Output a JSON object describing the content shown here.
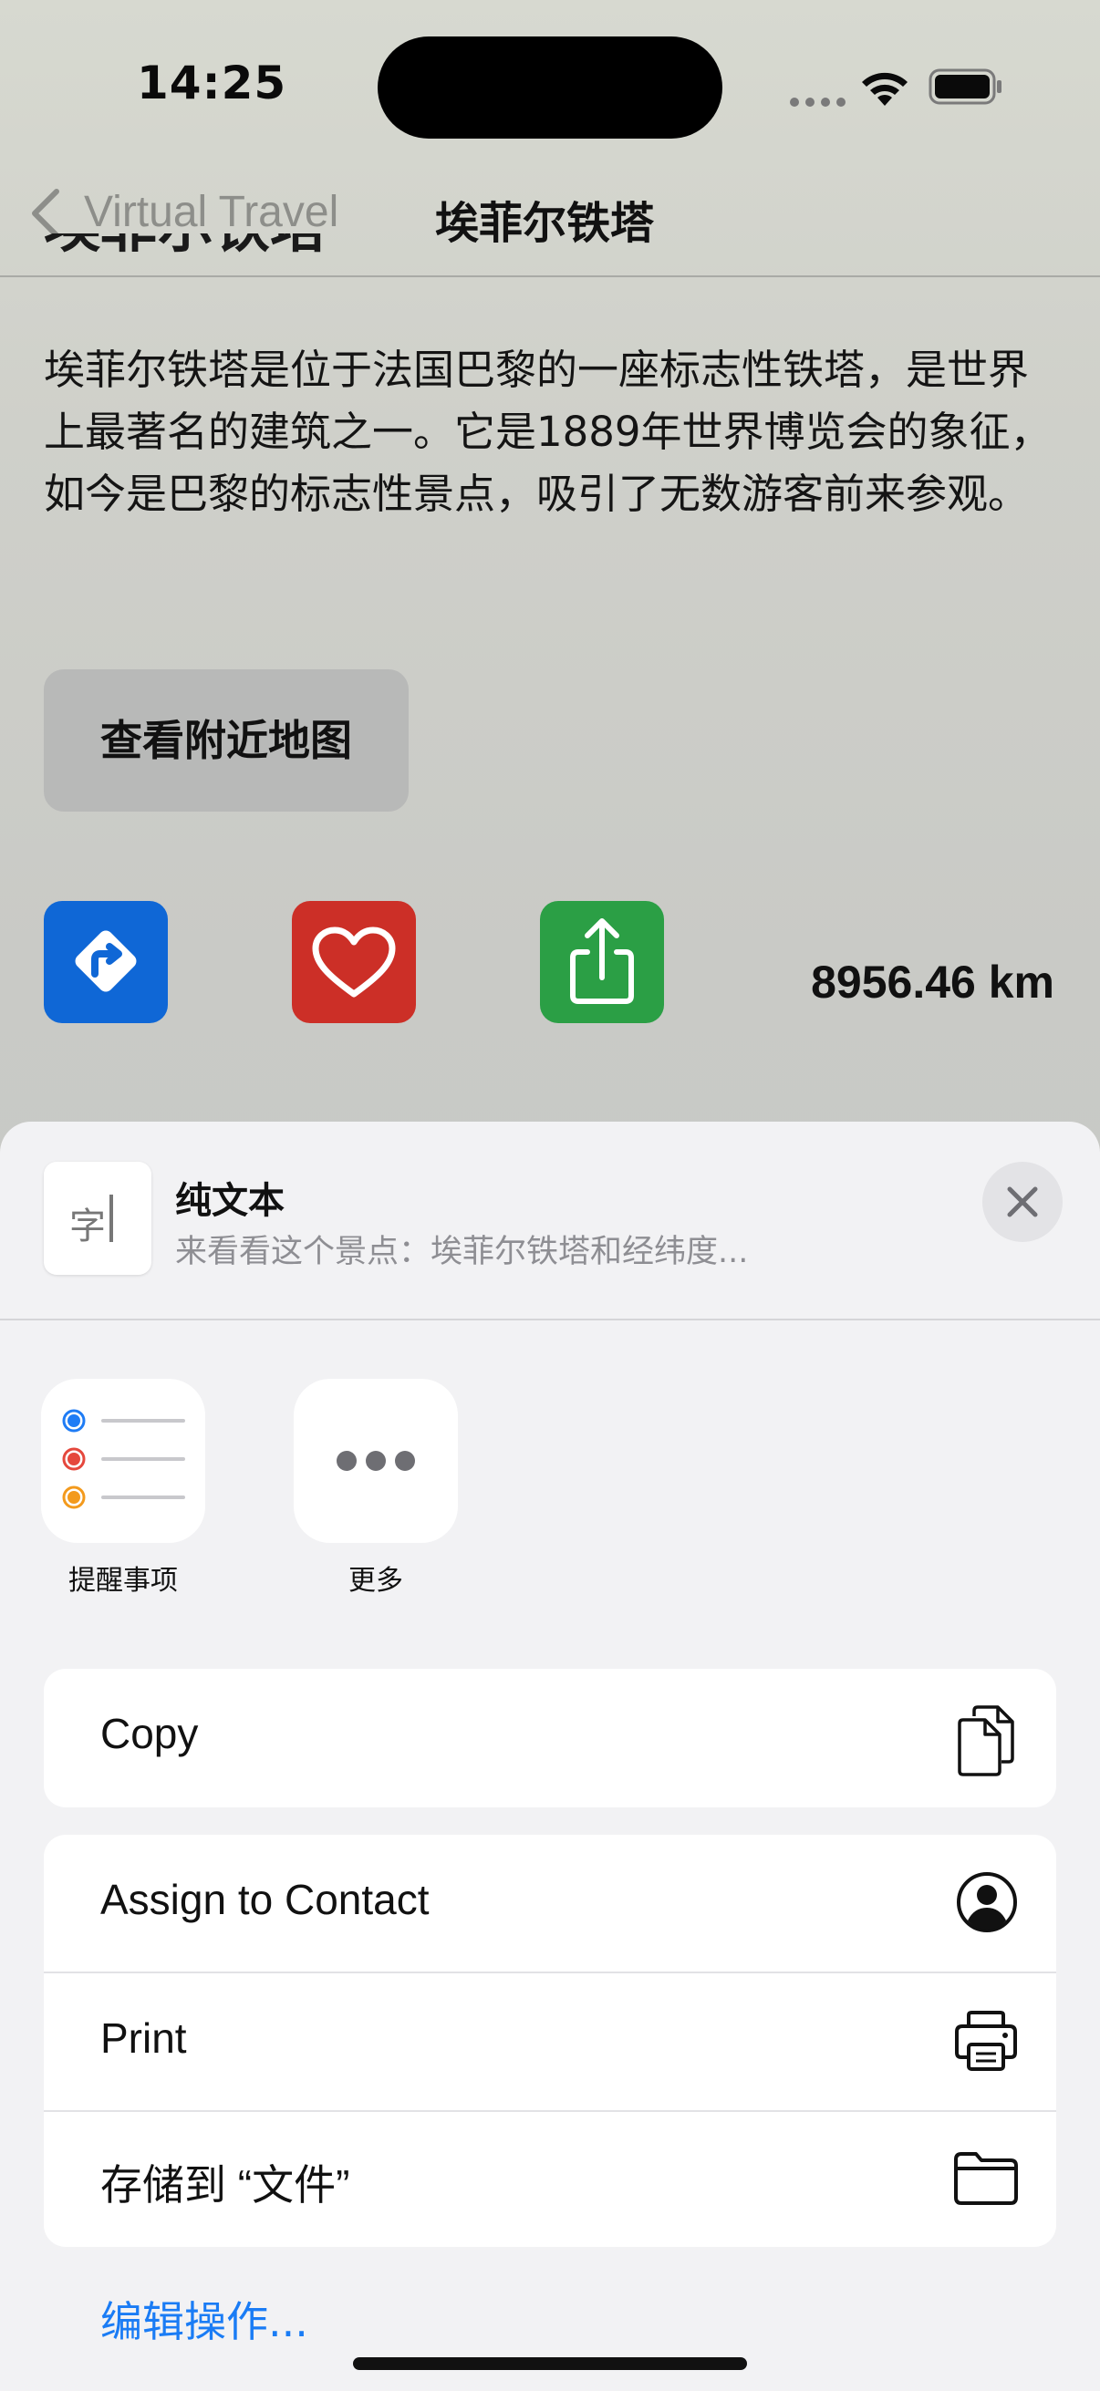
{
  "status_bar": {
    "time": "14:25"
  },
  "nav": {
    "back_label": "Virtual Travel",
    "title": "埃菲尔铁塔"
  },
  "content": {
    "heading": "埃菲尔铁塔",
    "description": "埃菲尔铁塔是位于法国巴黎的一座标志性铁塔，是世界上最著名的建筑之一。它是1889年世界博览会的象征，如今是巴黎的标志性景点，吸引了无数游客前来参观。",
    "map_button": "查看附近地图",
    "distance": "8956.46 km",
    "action_icons": [
      "directions-icon",
      "heart-icon",
      "share-icon"
    ],
    "colors": {
      "route": "#0f67d6",
      "favorite": "#cc2f27",
      "share": "#2b9f45"
    }
  },
  "share_sheet": {
    "thumb_text": "字",
    "title": "纯文本",
    "subtitle": "来看看这个景点：埃菲尔铁塔和经纬度...",
    "apps": [
      {
        "label": "提醒事项",
        "icon": "reminders-icon"
      },
      {
        "label": "更多",
        "icon": "more-icon"
      }
    ],
    "copy": {
      "label": "Copy",
      "icon": "copy-icon"
    },
    "actions": [
      {
        "label": "Assign to Contact",
        "icon": "contact-icon"
      },
      {
        "label": "Print",
        "icon": "printer-icon"
      },
      {
        "label": "存储到 “文件”",
        "icon": "folder-icon"
      }
    ],
    "edit_actions": "编辑操作...",
    "accent_color": "#1a7cf5"
  }
}
